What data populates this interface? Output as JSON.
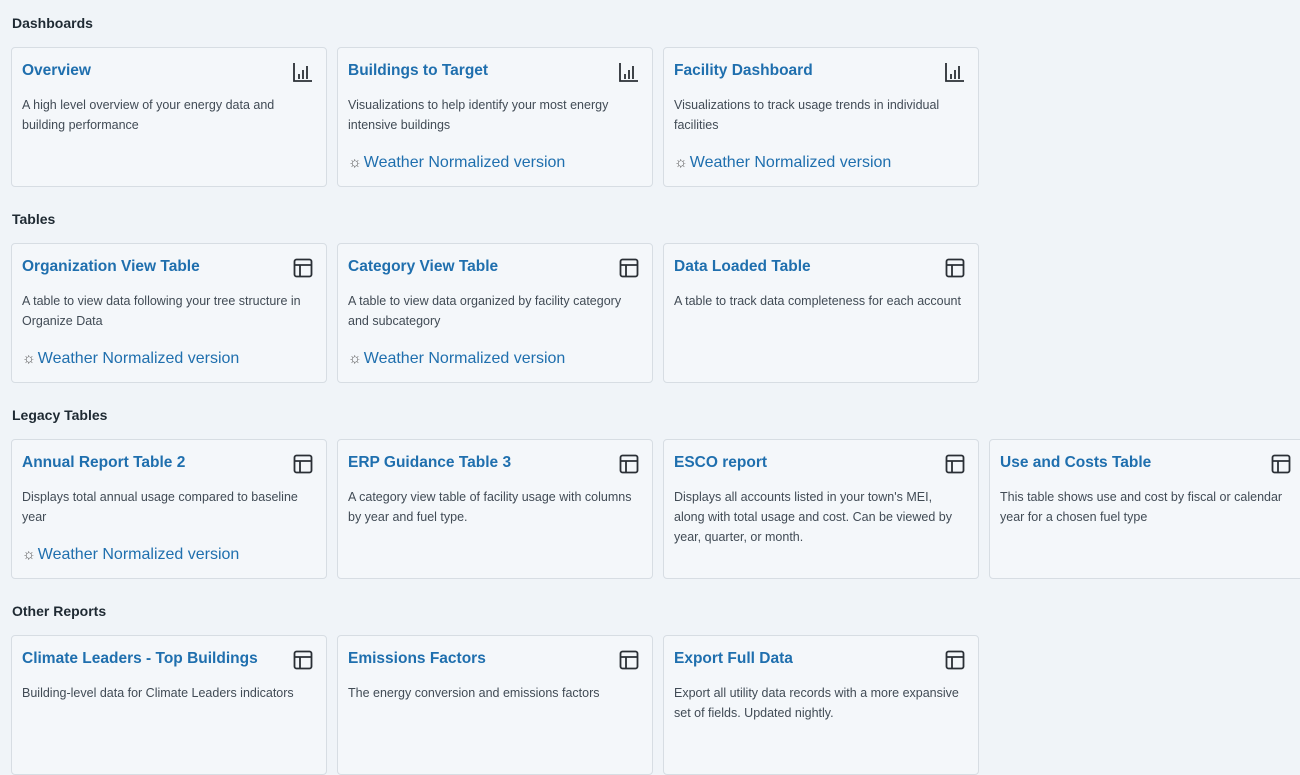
{
  "sections": [
    {
      "title": "Dashboards",
      "cards": [
        {
          "title": "Overview",
          "icon": "bar-chart-icon",
          "description": "A high level overview of your energy data and building performance",
          "link": ""
        },
        {
          "title": "Buildings to Target",
          "icon": "bar-chart-icon",
          "description": "Visualizations to help identify your most energy intensive buildings",
          "link": "Weather Normalized version"
        },
        {
          "title": "Facility Dashboard",
          "icon": "bar-chart-icon",
          "description": "Visualizations to track usage trends in individual facilities",
          "link": "Weather Normalized version"
        }
      ]
    },
    {
      "title": "Tables",
      "cards": [
        {
          "title": "Organization View Table",
          "icon": "table-icon",
          "description": "A table to view data following your tree structure in Organize Data",
          "link": "Weather Normalized version"
        },
        {
          "title": "Category View Table",
          "icon": "table-icon",
          "description": "A table to view data organized by facility category and subcategory",
          "link": "Weather Normalized version"
        },
        {
          "title": "Data Loaded Table",
          "icon": "table-icon",
          "description": "A table to track data completeness for each account",
          "link": ""
        }
      ]
    },
    {
      "title": "Legacy Tables",
      "cards": [
        {
          "title": "Annual Report Table 2",
          "icon": "table-icon",
          "description": "Displays total annual usage compared to baseline year",
          "link": "Weather Normalized version"
        },
        {
          "title": "ERP Guidance Table 3",
          "icon": "table-icon",
          "description": "A category view table of facility usage with columns by year and fuel type.",
          "link": ""
        },
        {
          "title": "ESCO report",
          "icon": "table-icon",
          "description": "Displays all accounts listed in your town's MEI, along with total usage and cost. Can be viewed by year, quarter, or month.",
          "link": ""
        },
        {
          "title": "Use and Costs Table",
          "icon": "table-icon",
          "description": "This table shows use and cost by fiscal or calendar year for a chosen fuel type",
          "link": ""
        }
      ]
    },
    {
      "title": "Other Reports",
      "cards": [
        {
          "title": "Climate Leaders - Top Buildings",
          "icon": "table-icon",
          "description": "Building-level data for Climate Leaders indicators",
          "link": ""
        },
        {
          "title": "Emissions Factors",
          "icon": "table-icon",
          "description": "The energy conversion and emissions factors",
          "link": ""
        },
        {
          "title": "Export Full Data",
          "icon": "table-icon",
          "description": "Export all utility data records with a more expansive set of fields. Updated nightly.",
          "link": ""
        }
      ]
    }
  ],
  "colors": {
    "accent": "#1f6fae",
    "background": "#f0f4f8",
    "card_border": "#d7dde3"
  }
}
